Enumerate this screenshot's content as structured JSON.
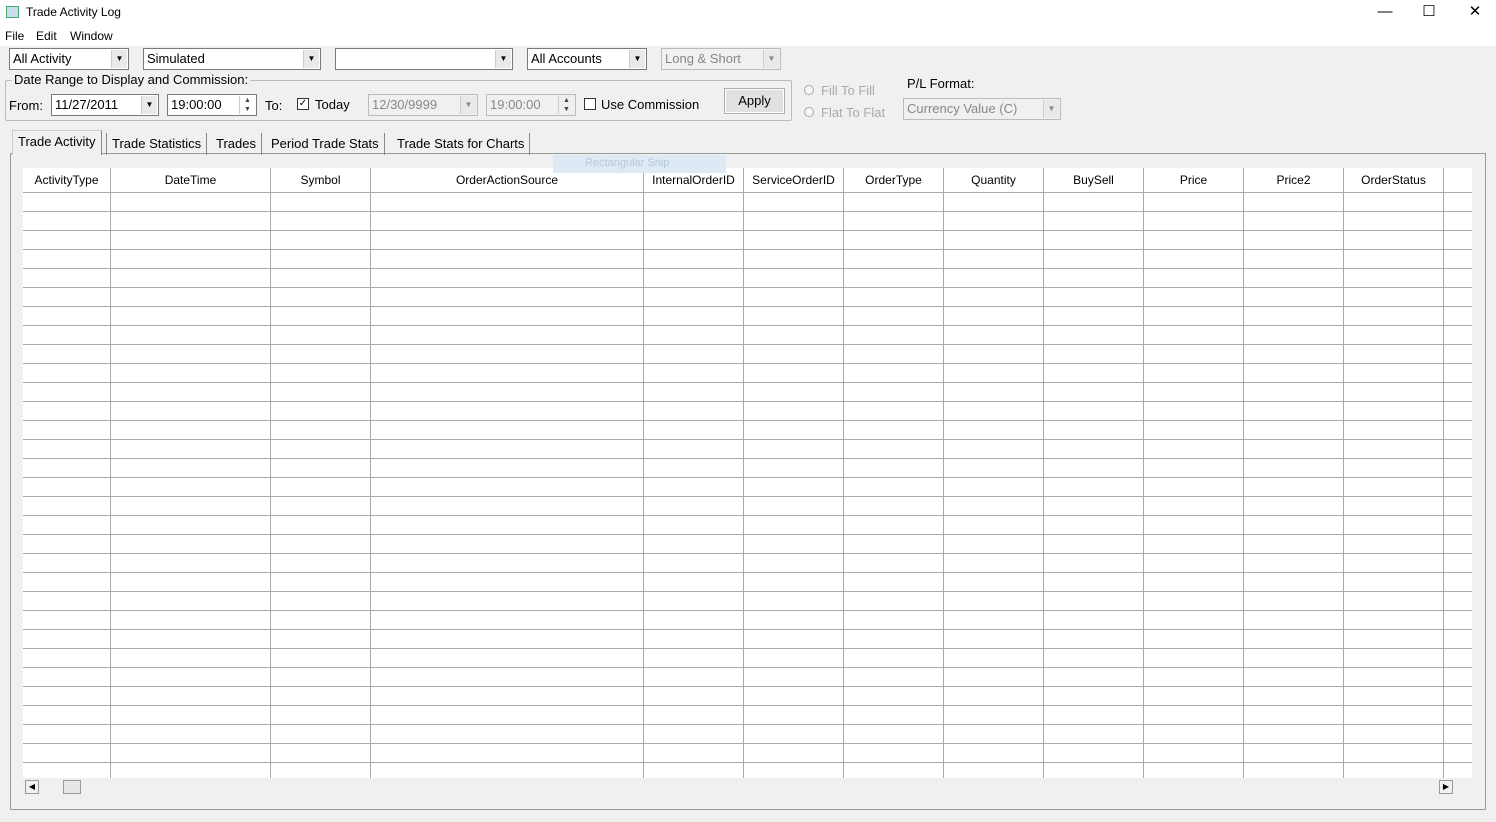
{
  "window": {
    "title": "Trade Activity Log",
    "minimize": "—",
    "maximize": "☐",
    "close": "✕"
  },
  "menu": [
    "File",
    "Edit",
    "Window"
  ],
  "filters": {
    "activity": "All Activity",
    "mode": "Simulated",
    "symbol": "",
    "account": "All Accounts",
    "side": "Long & Short"
  },
  "date_range": {
    "legend": "Date Range to Display and Commission:",
    "from_label": "From:",
    "from_date": "11/27/2011",
    "from_time": "19:00:00",
    "to_label": "To:",
    "today_label": "Today",
    "today_checked": true,
    "to_date": "12/30/9999",
    "to_time": "19:00:00",
    "commission_label": "Use Commission",
    "commission_checked": false,
    "apply": "Apply"
  },
  "pl": {
    "fill_to_fill": "Fill To Fill",
    "flat_to_flat": "Flat To Flat",
    "format_label": "P/L Format:",
    "format_value": "Currency Value (C)"
  },
  "tabs": [
    "Trade Activity",
    "Trade Statistics",
    "Trades",
    "Period Trade Stats",
    "Trade Stats for Charts"
  ],
  "active_tab": 0,
  "overlay": "Rectangular Snip",
  "table": {
    "columns": [
      "ActivityType",
      "DateTime",
      "Symbol",
      "OrderActionSource",
      "InternalOrderID",
      "ServiceOrderID",
      "OrderType",
      "Quantity",
      "BuySell",
      "Price",
      "Price2",
      "OrderStatus"
    ],
    "rows": []
  }
}
